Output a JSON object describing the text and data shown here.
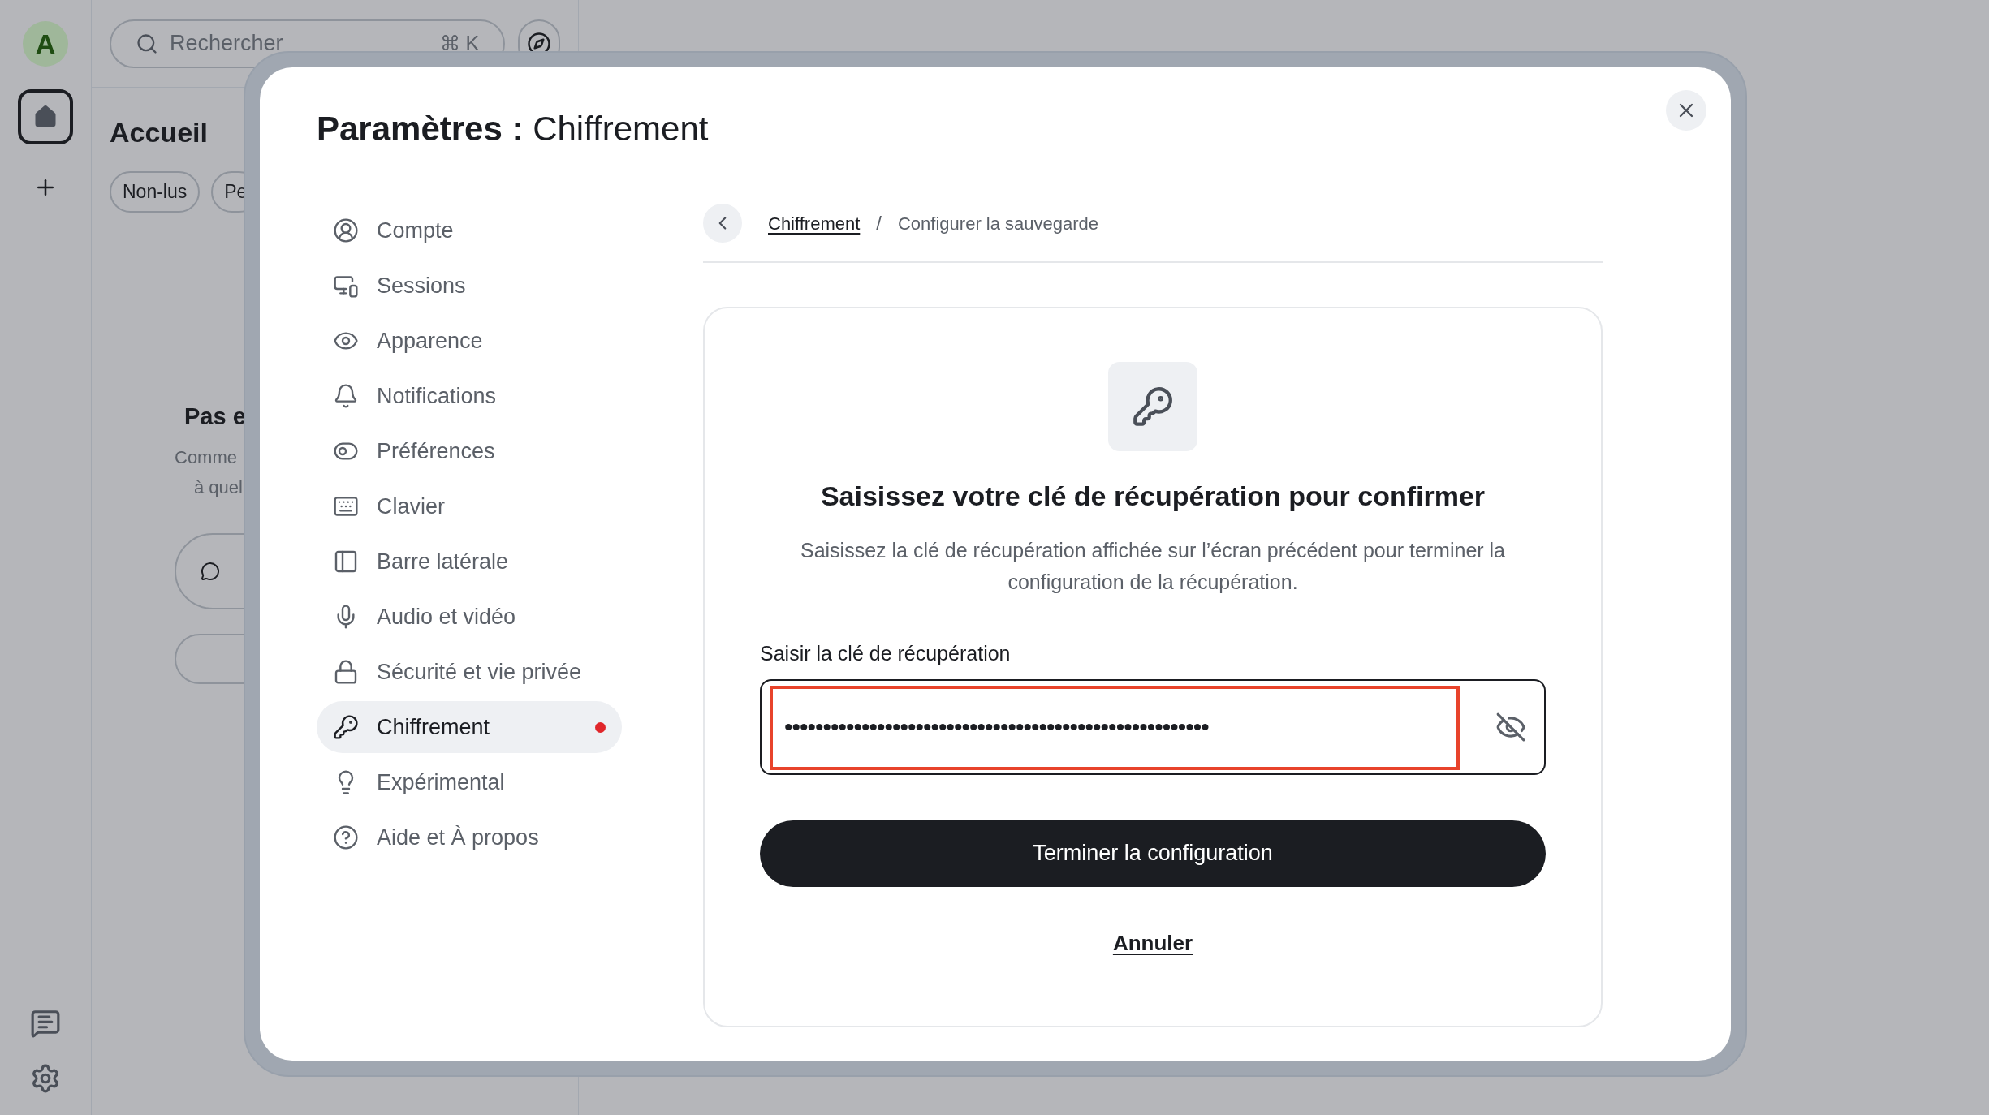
{
  "background": {
    "rail": {
      "avatar": "A",
      "items": [
        {
          "kind": "home",
          "selected": true
        },
        {
          "kind": "add",
          "selected": false
        }
      ]
    },
    "search": {
      "placeholder": "Rechercher",
      "shortcut": "⌘ K"
    },
    "title": "Accueil",
    "filters": [
      "Non-lus",
      "Pe"
    ],
    "empty": {
      "title": "Pas e",
      "lines": [
        "Comme",
        "à quel"
      ]
    }
  },
  "dialog": {
    "title_bold": "Paramètres :",
    "title": "Chiffrement",
    "nav": [
      {
        "label": "Compte",
        "selected": false,
        "badge": false
      },
      {
        "label": "Sessions",
        "selected": false,
        "badge": false
      },
      {
        "label": "Apparence",
        "selected": false,
        "badge": false
      },
      {
        "label": "Notifications",
        "selected": false,
        "badge": false
      },
      {
        "label": "Préférences",
        "selected": false,
        "badge": false
      },
      {
        "label": "Clavier",
        "selected": false,
        "badge": false
      },
      {
        "label": "Barre latérale",
        "selected": false,
        "badge": false
      },
      {
        "label": "Audio et vidéo",
        "selected": false,
        "badge": false
      },
      {
        "label": "Sécurité et vie privée",
        "selected": false,
        "badge": false
      },
      {
        "label": "Chiffrement",
        "selected": true,
        "badge": true
      },
      {
        "label": "Expérimental",
        "selected": false,
        "badge": false
      },
      {
        "label": "Aide et À propos",
        "selected": false,
        "badge": false
      }
    ],
    "breadcrumb": {
      "link": "Chiffrement",
      "separator": "/",
      "current": "Configurer la sauvegarde"
    },
    "card": {
      "heading": "Saisissez votre clé de récupération pour confirmer",
      "description": "Saisissez la clé de récupération affichée sur l’écran précédent pour terminer la configuration de la récupération.",
      "field": {
        "label": "Saisir la clé de récupération",
        "value": "•••••••••••••••••••••••••••••••••••••••••••••••••••••••",
        "highlighted": true
      },
      "primary": "Terminer la configuration",
      "cancel": "Annuler"
    }
  }
}
